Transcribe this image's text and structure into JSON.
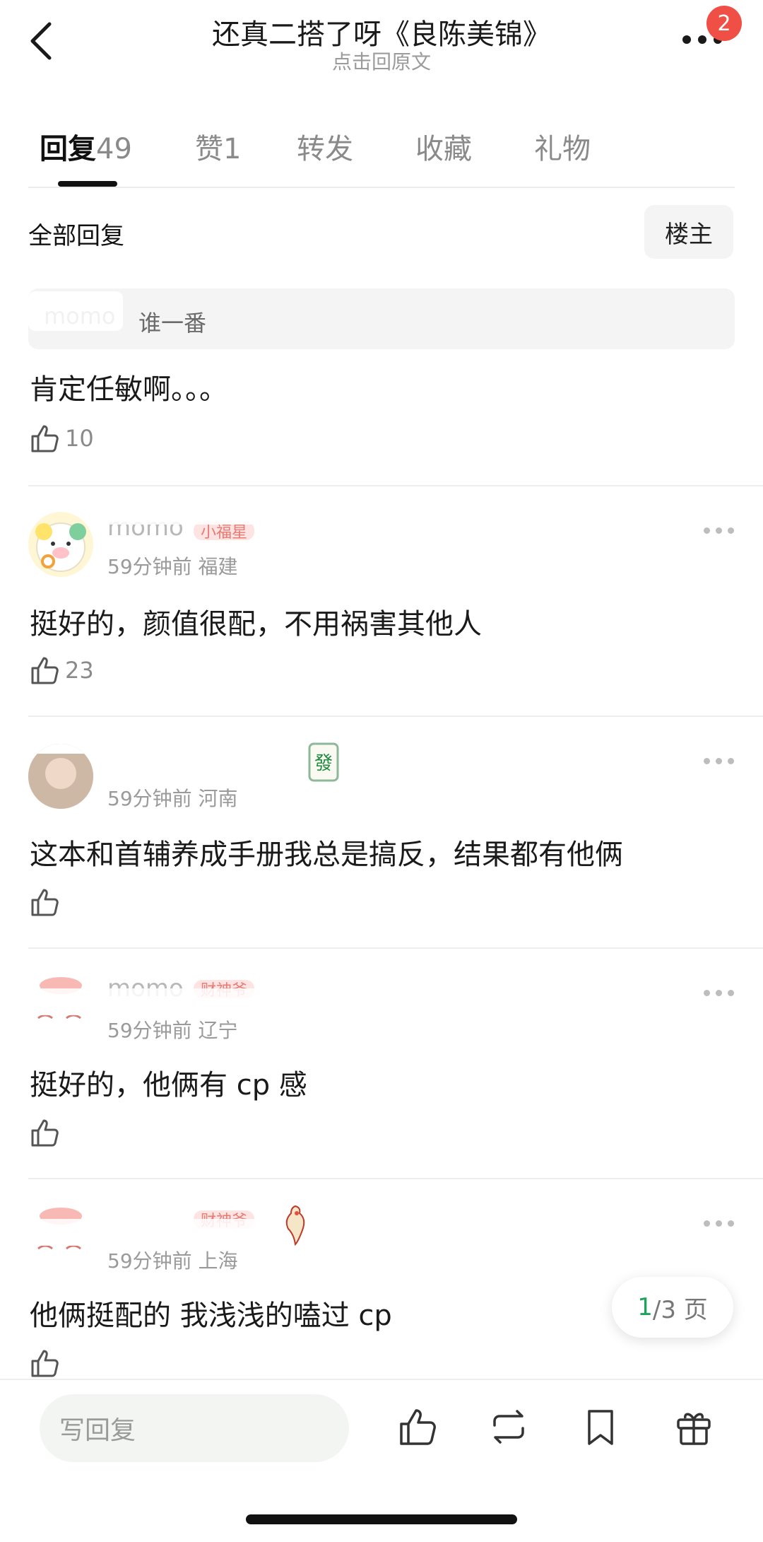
{
  "header": {
    "title": "还真二搭了呀《良陈美锦》",
    "subtitle": "点击回原文",
    "notification_count": "2"
  },
  "tabs": [
    {
      "label": "回复",
      "count": "49"
    },
    {
      "label": "赞",
      "count": "1"
    },
    {
      "label": "转发",
      "count": ""
    },
    {
      "label": "收藏",
      "count": ""
    },
    {
      "label": "礼物",
      "count": ""
    }
  ],
  "section": {
    "title": "全部回复",
    "owner_filter": "楼主"
  },
  "first_reply": {
    "quote_user": "momo",
    "quote_text": "谁一番",
    "text": "肯定任敏啊。。。",
    "likes": "10"
  },
  "replies": [
    {
      "user": "momo",
      "badge": "小福星",
      "time": "59分钟前",
      "location": "福建",
      "text": "挺好的，颜值很配，不用祸害其他人",
      "likes": "23"
    },
    {
      "user": "",
      "badge": "",
      "time": "59分钟前",
      "location": "河南",
      "text": "这本和首辅养成手册我总是搞反，结果都有他俩",
      "likes": ""
    },
    {
      "user": "momo",
      "badge": "财神爷",
      "time": "59分钟前",
      "location": "辽宁",
      "text": "挺好的，他俩有 cp 感",
      "likes": ""
    },
    {
      "user": "",
      "badge": "财神爷",
      "time": "59分钟前",
      "location": "上海",
      "text": "他俩挺配的 我浅浅的嗑过 cp",
      "likes": ""
    }
  ],
  "pagination": {
    "current": "1",
    "total": "/3 页"
  },
  "bottom_bar": {
    "reply_placeholder": "写回复"
  },
  "icons": [
    "back-arrow-icon",
    "more-icon",
    "thumb-up-icon",
    "repost-icon",
    "bookmark-icon",
    "gift-icon",
    "mahjong-fa-icon",
    "rooster-icon"
  ],
  "colors": {
    "badge_red": "#f04f45",
    "page_green": "#1fa35c",
    "tag_bg": "#fde4e2"
  }
}
